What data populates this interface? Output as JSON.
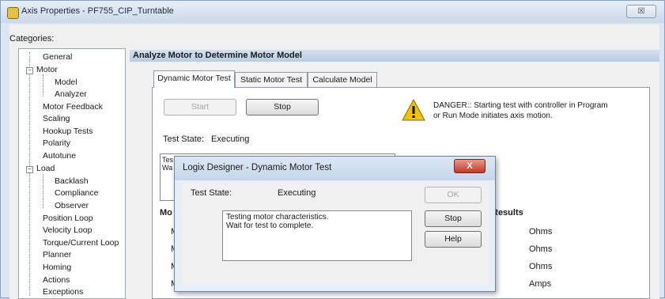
{
  "window": {
    "title": "Axis Properties - PF755_CIP_Turntable",
    "close_glyph": "☒"
  },
  "categories_label": "Categories:",
  "tree": [
    {
      "label": "General"
    },
    {
      "label": "Motor"
    },
    {
      "label": "Model"
    },
    {
      "label": "Analyzer"
    },
    {
      "label": "Motor Feedback"
    },
    {
      "label": "Scaling"
    },
    {
      "label": "Hookup Tests"
    },
    {
      "label": "Polarity"
    },
    {
      "label": "Autotune"
    },
    {
      "label": "Load"
    },
    {
      "label": "Backlash"
    },
    {
      "label": "Compliance"
    },
    {
      "label": "Observer"
    },
    {
      "label": "Position Loop"
    },
    {
      "label": "Velocity Loop"
    },
    {
      "label": "Torque/Current Loop"
    },
    {
      "label": "Planner"
    },
    {
      "label": "Homing"
    },
    {
      "label": "Actions"
    },
    {
      "label": "Exceptions"
    }
  ],
  "section_header": "Analyze Motor to Determine Motor Model",
  "tabs": [
    {
      "label": "Dynamic Motor Test"
    },
    {
      "label": "Static Motor Test"
    },
    {
      "label": "Calculate Model"
    }
  ],
  "start_label": "Start",
  "stop_label": "Stop",
  "danger_text": "DANGER:: Starting test with controller in Program or Run Mode initiates axis motion.",
  "test_state_label": "Test State:",
  "test_state_value": "Executing",
  "partial": {
    "te": "Tes",
    "wa": "Wa",
    "mo": "Mo",
    "results": "Results",
    "m": "M",
    "units": [
      "Ohms",
      "Ohms",
      "Ohms",
      "Amps"
    ]
  },
  "dialog": {
    "title": "Logix Designer - Dynamic Motor Test",
    "close_glyph": "X",
    "test_state_label": "Test State:",
    "test_state_value": "Executing",
    "ok_label": "OK",
    "stop_label": "Stop",
    "help_label": "Help",
    "message_line1": "Testing motor characteristics.",
    "message_line2": "Wait for test to complete."
  },
  "colors": {
    "accent_header": "#b9cce4",
    "warning": "#f2c200",
    "dialog_close": "#c2392a"
  }
}
